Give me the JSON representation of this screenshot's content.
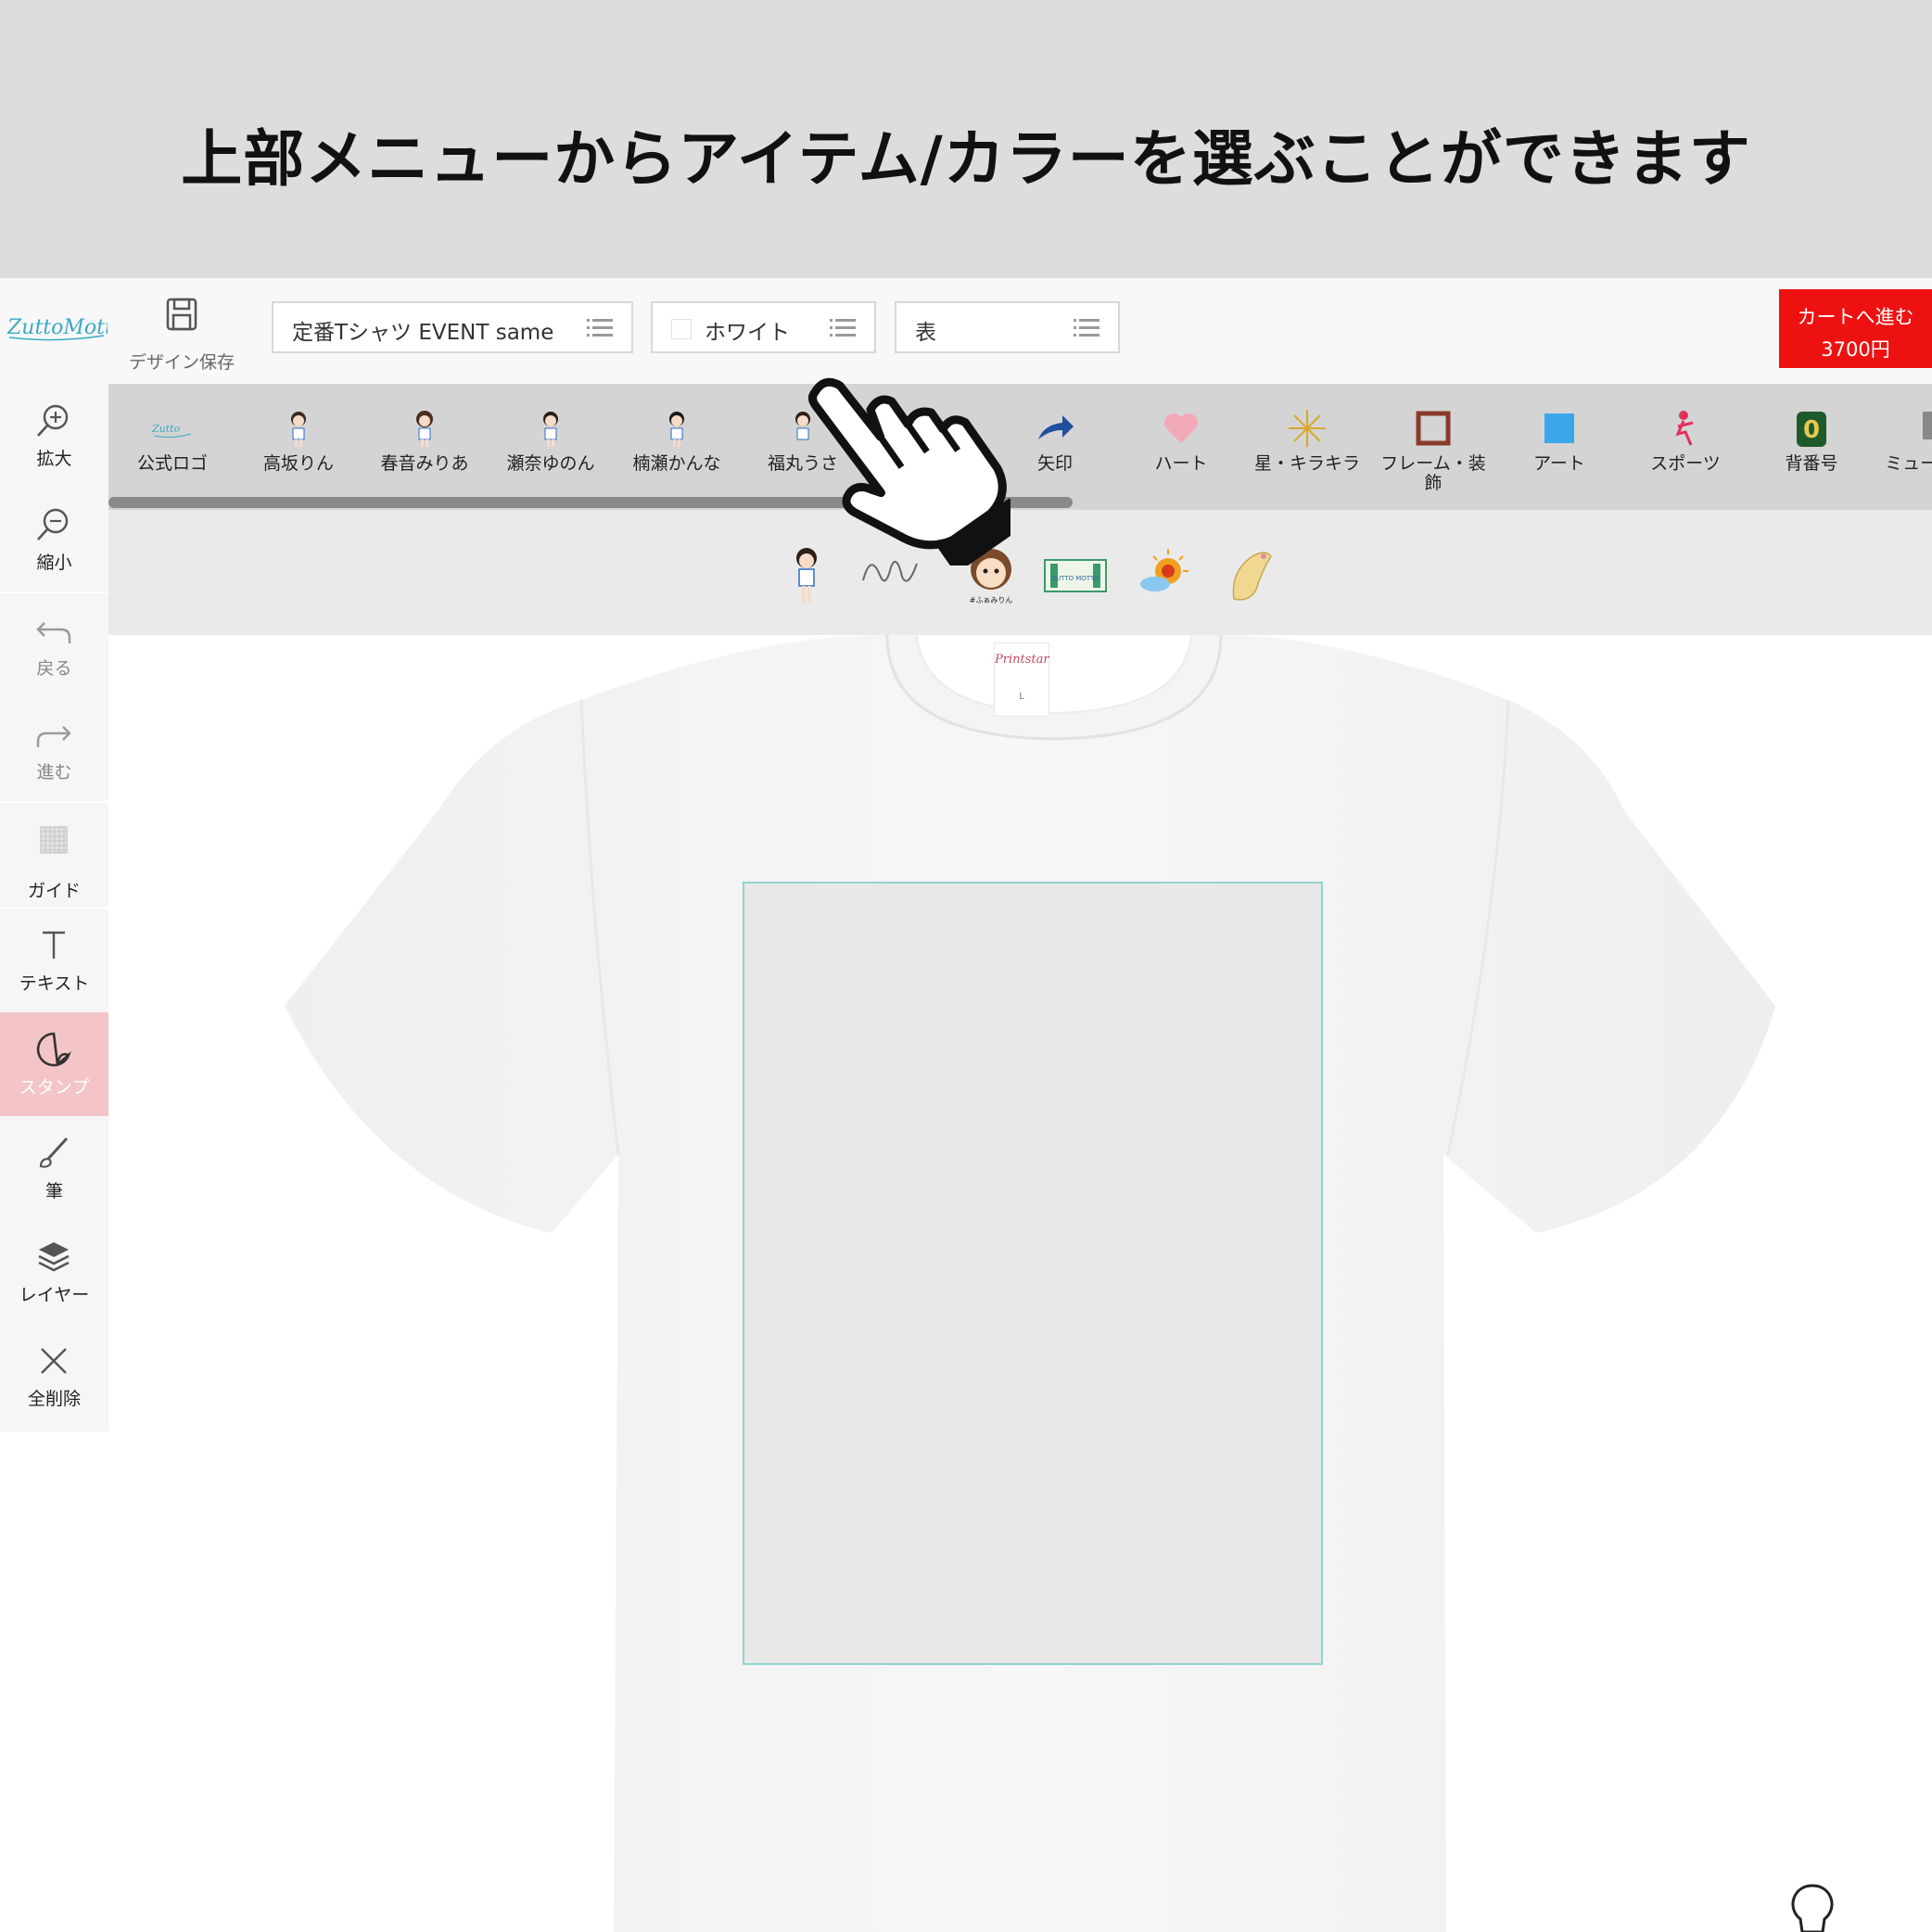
{
  "banner": {
    "text": "上部メニューからアイテム/カラーを選ぶことができます"
  },
  "header": {
    "logo_text": "ZuttoMotto",
    "save_label": "デザイン保存",
    "item_select": {
      "value": "定番Tシャツ EVENT same"
    },
    "color_select": {
      "value": "ホワイト",
      "swatch_color": "#ffffff"
    },
    "side_select": {
      "value": "表"
    },
    "cart": {
      "label": "カートへ進む",
      "price": "3700円",
      "color": "#ee1111"
    }
  },
  "sidebar": {
    "tools": [
      {
        "label": "拡大",
        "icon": "zoom-in-icon"
      },
      {
        "label": "縮小",
        "icon": "zoom-out-icon"
      },
      {
        "label": "戻る",
        "icon": "undo-icon"
      },
      {
        "label": "進む",
        "icon": "redo-icon"
      },
      {
        "label": "ガイド",
        "icon": "grid-icon"
      },
      {
        "label": "テキスト",
        "icon": "text-icon"
      },
      {
        "label": "スタンプ",
        "icon": "sticker-icon",
        "active": true
      },
      {
        "label": "筆",
        "icon": "brush-icon"
      },
      {
        "label": "レイヤー",
        "icon": "layers-icon"
      },
      {
        "label": "全削除",
        "icon": "close-icon"
      }
    ]
  },
  "categories": [
    {
      "label": "公式ロゴ",
      "icon": "logo-thumb"
    },
    {
      "label": "高坂りん",
      "icon": "character-thumb"
    },
    {
      "label": "春音みりあ",
      "icon": "character-thumb"
    },
    {
      "label": "瀬奈ゆのん",
      "icon": "character-thumb"
    },
    {
      "label": "楠瀬かんな",
      "icon": "character-thumb"
    },
    {
      "label": "福丸うさ",
      "icon": "character-thumb"
    },
    {
      "label": "",
      "icon": ""
    },
    {
      "label": "矢印",
      "icon": "arrow-thumb"
    },
    {
      "label": "ハート",
      "icon": "heart-thumb"
    },
    {
      "label": "星・キラキラ",
      "icon": "star-thumb"
    },
    {
      "label": "フレーム・装飾",
      "icon": "frame-thumb"
    },
    {
      "label": "アート",
      "icon": "art-thumb"
    },
    {
      "label": "スポーツ",
      "icon": "sports-thumb"
    },
    {
      "label": "背番号",
      "icon": "number-thumb"
    },
    {
      "label": "ミュージック",
      "icon": "music-thumb"
    }
  ],
  "stamps": [
    {
      "name": "character-stamp"
    },
    {
      "name": "signature-stamp"
    },
    {
      "name": "face-stamp"
    },
    {
      "name": "ticket-stamp"
    },
    {
      "name": "sun-stamp"
    },
    {
      "name": "shrimp-stamp"
    }
  ],
  "stamp_texts": {
    "face": "#ふぁみりん",
    "ticket": "ZUTTO MOTTO"
  },
  "canvas": {
    "shirt_color": "#ffffff",
    "tag_brand": "Printstar",
    "tag_size": "L",
    "print_area_border": "#8fd3d2"
  },
  "colors": {
    "accent_active": "#f3c5c7",
    "logo": "#39a9c3"
  }
}
